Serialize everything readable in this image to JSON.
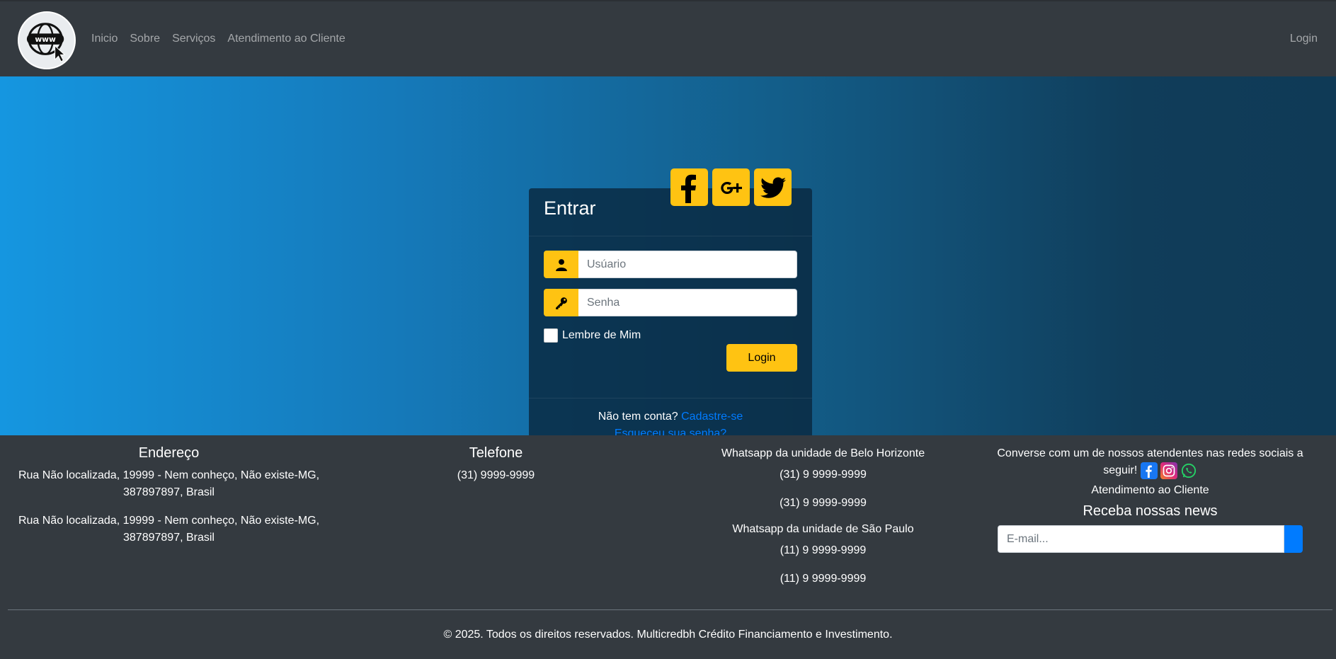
{
  "nav": {
    "links": [
      "Inicio",
      "Sobre",
      "Serviços",
      "Atendimento ao Cliente"
    ],
    "login": "Login"
  },
  "login_card": {
    "title": "Entrar",
    "username_placeholder": "Usúario",
    "password_placeholder": "Senha",
    "remember_label": "Lembre de Mim",
    "submit_label": "Login",
    "no_account_text": "Não tem conta?",
    "signup_link": "Cadastre-se",
    "forgot_link": "Esqueceu sua senha?"
  },
  "footer": {
    "address": {
      "title": "Endereço",
      "lines": [
        "Rua Não localizada, 19999 - Nem conheço, Não existe-MG, 387897897, Brasil",
        "Rua Não localizada, 19999 - Nem conheço, Não existe-MG, 387897897, Brasil"
      ]
    },
    "phone": {
      "title": "Telefone",
      "number": "(31) 9999-9999"
    },
    "whatsapp": {
      "bh_title": "Whatsapp da unidade de Belo Horizonte",
      "bh_numbers": [
        "(31) 9 9999-9999",
        "(31) 9 9999-9999"
      ],
      "sp_title": "Whatsapp da unidade de São Paulo",
      "sp_numbers": [
        "(11) 9 9999-9999",
        "(11) 9 9999-9999"
      ]
    },
    "contact": {
      "text": "Converse com um de nossos atendentes nas redes sociais a seguir!",
      "support_link": "Atendimento ao Cliente",
      "news_title": "Receba nossas news",
      "email_placeholder": "E-mail..."
    },
    "copyright": "© 2025. Todos os direitos reservados. Multicredbh Crédito Financiamento e Investimento."
  },
  "colors": {
    "accent": "#ffc312",
    "link": "#007bff",
    "nav_bg": "#343a40"
  },
  "icons": [
    "www-logo-icon",
    "facebook-icon",
    "google-plus-icon",
    "twitter-icon",
    "user-icon",
    "key-icon",
    "instagram-icon",
    "whatsapp-icon"
  ]
}
